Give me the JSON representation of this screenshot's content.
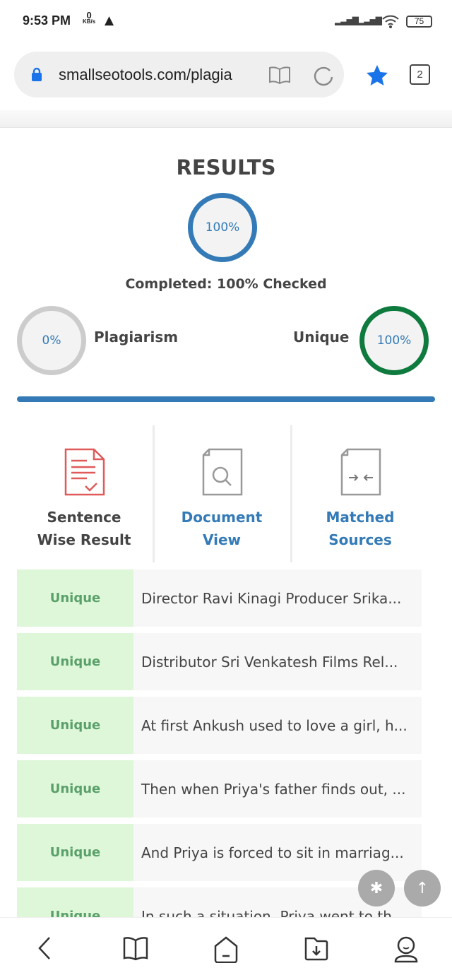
{
  "status": {
    "time": "9:53 PM",
    "speed_value": "0",
    "speed_unit": "KB/s",
    "battery": "75"
  },
  "browser": {
    "url": "smallseotools.com/plagia",
    "tab_count": "2",
    "accent": "#1a73e8"
  },
  "results": {
    "title": "RESULTS",
    "progress_label": "100%",
    "progress": 100,
    "completed": "Completed: 100% Checked",
    "plagiarism": {
      "label": "Plagiarism",
      "value": "0%"
    },
    "unique": {
      "label": "Unique",
      "value": "100%"
    }
  },
  "options": [
    {
      "label_line1": "Sentence",
      "label_line2": "Wise Result",
      "icon": "document-check-icon"
    },
    {
      "label_line1": "Document",
      "label_line2": "View",
      "icon": "document-search-icon"
    },
    {
      "label_line1": "Matched",
      "label_line2": "Sources",
      "icon": "document-compare-icon"
    }
  ],
  "sentences": [
    {
      "status": "Unique",
      "text": "Director Ravi Kinagi Producer Srika..."
    },
    {
      "status": "Unique",
      "text": "Distributor Sri Venkatesh Films Rel..."
    },
    {
      "status": "Unique",
      "text": "At first Ankush used to love a girl, h..."
    },
    {
      "status": "Unique",
      "text": "Then when Priya's father finds out, ..."
    },
    {
      "status": "Unique",
      "text": "And Priya is forced to sit in marriag..."
    },
    {
      "status": "Unique",
      "text": "In such a situation, Priya went to th"
    }
  ],
  "colors": {
    "blue": "#337ab7",
    "green": "#0f7a3e",
    "red": "#e05a5a",
    "unique_bg": "#dff7d9"
  }
}
